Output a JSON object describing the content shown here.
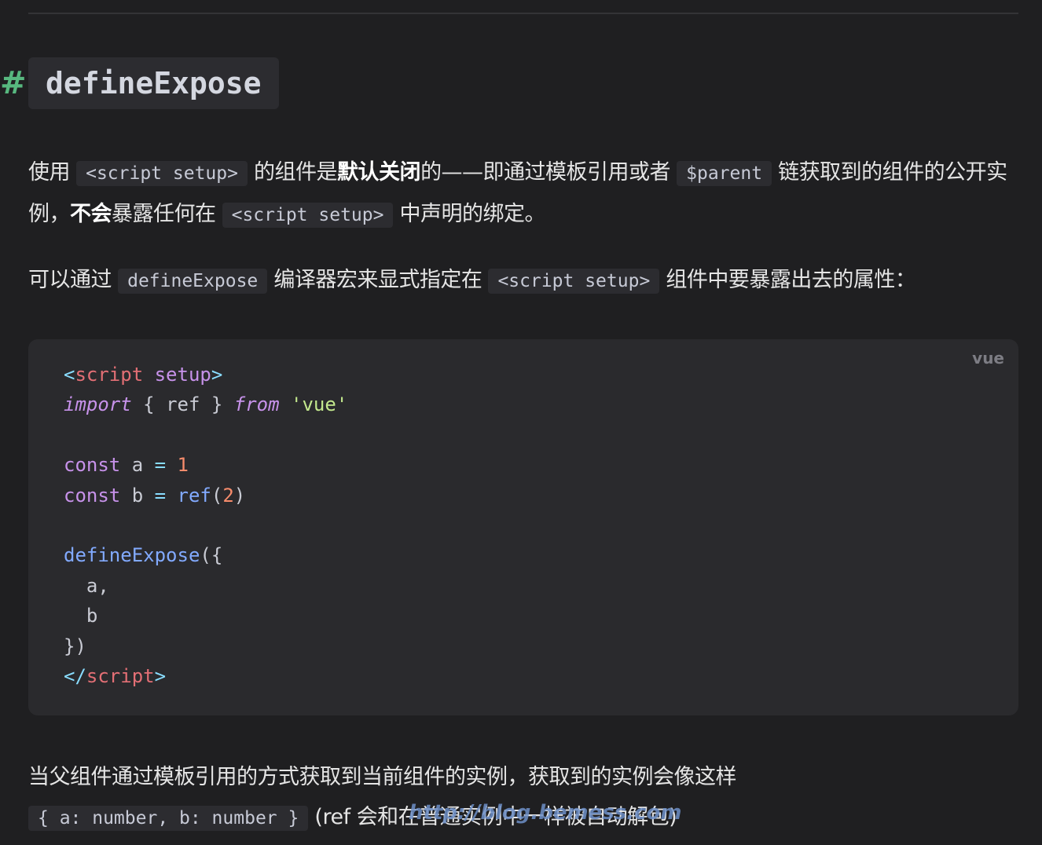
{
  "heading": {
    "anchor": "#",
    "title": "defineExpose"
  },
  "para1": {
    "t1": "使用 ",
    "c1": "<script setup>",
    "t2": " 的组件是",
    "b1": "默认关闭",
    "t3": "的——即通过模板引用或者 ",
    "c2": "$parent",
    "t4": " 链获取到的组件的公开实例，",
    "b2": "不会",
    "t5": "暴露任何在 ",
    "c3": "<script setup>",
    "t6": " 中声明的绑定。"
  },
  "para2": {
    "t1": "可以通过 ",
    "c1": "defineExpose",
    "t2": " 编译器宏来显式指定在 ",
    "c2": "<script setup>",
    "t3": " 组件中要暴露出去的属性："
  },
  "code": {
    "lang": "vue",
    "line1": {
      "lt": "<",
      "tag": "script",
      "attr": "setup",
      "gt": ">"
    },
    "line2": {
      "kw_import": "import",
      "open": " { ",
      "name": "ref",
      "close": " } ",
      "kw_from": "from",
      "str": "'vue'"
    },
    "line4": {
      "kw": "const",
      "name": "a",
      "eq": "=",
      "num": "1"
    },
    "line5": {
      "kw": "const",
      "name": "b",
      "eq": "=",
      "fn": "ref",
      "lp": "(",
      "num": "2",
      "rp": ")"
    },
    "line7": {
      "fn": "defineExpose",
      "open": "({"
    },
    "line8": "a,",
    "line9": "b",
    "line10": "})",
    "line11": {
      "lt": "</",
      "tag": "script",
      "gt": ">"
    }
  },
  "para3": {
    "line1": "当父组件通过模板引用的方式获取到当前组件的实例，获取到的实例会像这样",
    "c1": "{ a: number, b: number }",
    "t2": " (ref 会和在普通实例中一样被自动解包)"
  },
  "watermark": "http://blog.bemess.com"
}
